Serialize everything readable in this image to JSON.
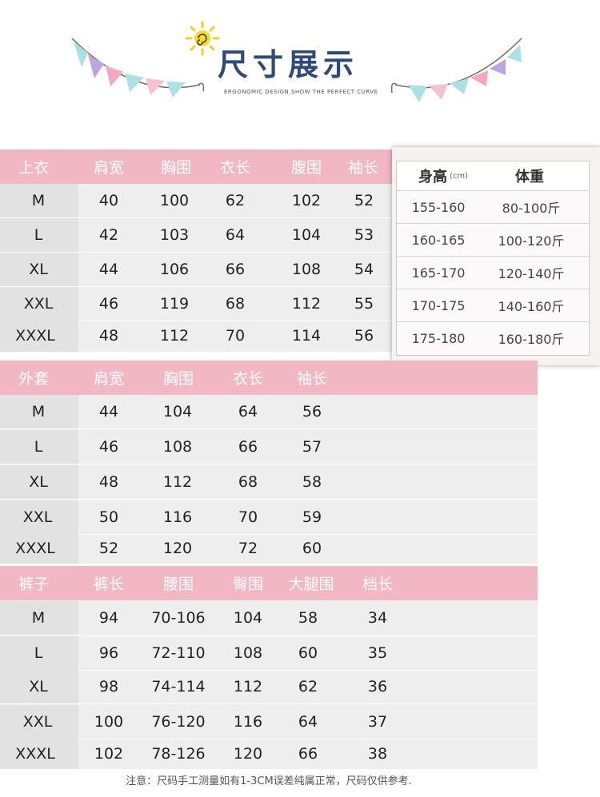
{
  "header": {
    "title": "尺寸展示",
    "subtitle": "ERGONOMIC DESIGN.SHOW THE PERFECT CURVE",
    "sun_icon": "sun-icon",
    "bunting_colors": [
      "#f2a9c0",
      "#b9a6e0",
      "#a9e1e4",
      "#f5c2cf"
    ]
  },
  "colors": {
    "header_pink": "#f1b7c3",
    "row_gray": "#eeeeee",
    "title_blue": "#2e4a7a"
  },
  "tops": {
    "headers": [
      "上衣",
      "肩宽",
      "胸围",
      "衣长",
      "腹围",
      "袖长"
    ],
    "rows": [
      [
        "M",
        "40",
        "100",
        "62",
        "102",
        "52"
      ],
      [
        "L",
        "42",
        "103",
        "64",
        "104",
        "53"
      ],
      [
        "XL",
        "44",
        "106",
        "66",
        "108",
        "54"
      ],
      [
        "XXL",
        "46",
        "119",
        "68",
        "112",
        "55"
      ],
      [
        "XXXL",
        "48",
        "112",
        "70",
        "114",
        "56"
      ]
    ]
  },
  "coat": {
    "headers": [
      "外套",
      "肩宽",
      "胸围",
      "衣长",
      "袖长"
    ],
    "rows": [
      [
        "M",
        "44",
        "104",
        "64",
        "56"
      ],
      [
        "L",
        "46",
        "108",
        "66",
        "57"
      ],
      [
        "XL",
        "48",
        "112",
        "68",
        "58"
      ],
      [
        "XXL",
        "50",
        "116",
        "70",
        "59"
      ],
      [
        "XXXL",
        "52",
        "120",
        "72",
        "60"
      ]
    ]
  },
  "pants": {
    "headers": [
      "裤子",
      "裤长",
      "腰围",
      "臀围",
      "大腿围",
      "档长"
    ],
    "rows": [
      [
        "M",
        "94",
        "70-106",
        "104",
        "58",
        "34"
      ],
      [
        "L",
        "96",
        "72-110",
        "108",
        "60",
        "35"
      ],
      [
        "XL",
        "98",
        "74-114",
        "112",
        "62",
        "36"
      ],
      [
        "XXL",
        "100",
        "76-120",
        "116",
        "64",
        "37"
      ],
      [
        "XXXL",
        "102",
        "78-126",
        "120",
        "66",
        "38"
      ]
    ]
  },
  "height_weight": {
    "height_header": "身高",
    "height_unit": "(cm)",
    "weight_header": "体重",
    "rows": [
      [
        "155-160",
        "80-100斤"
      ],
      [
        "160-165",
        "100-120斤"
      ],
      [
        "165-170",
        "120-140斤"
      ],
      [
        "170-175",
        "140-160斤"
      ],
      [
        "175-180",
        "160-180斤"
      ]
    ]
  },
  "note": "注意：尺码手工测量如有1-3CM误差纯属正常，尺码仅供参考."
}
